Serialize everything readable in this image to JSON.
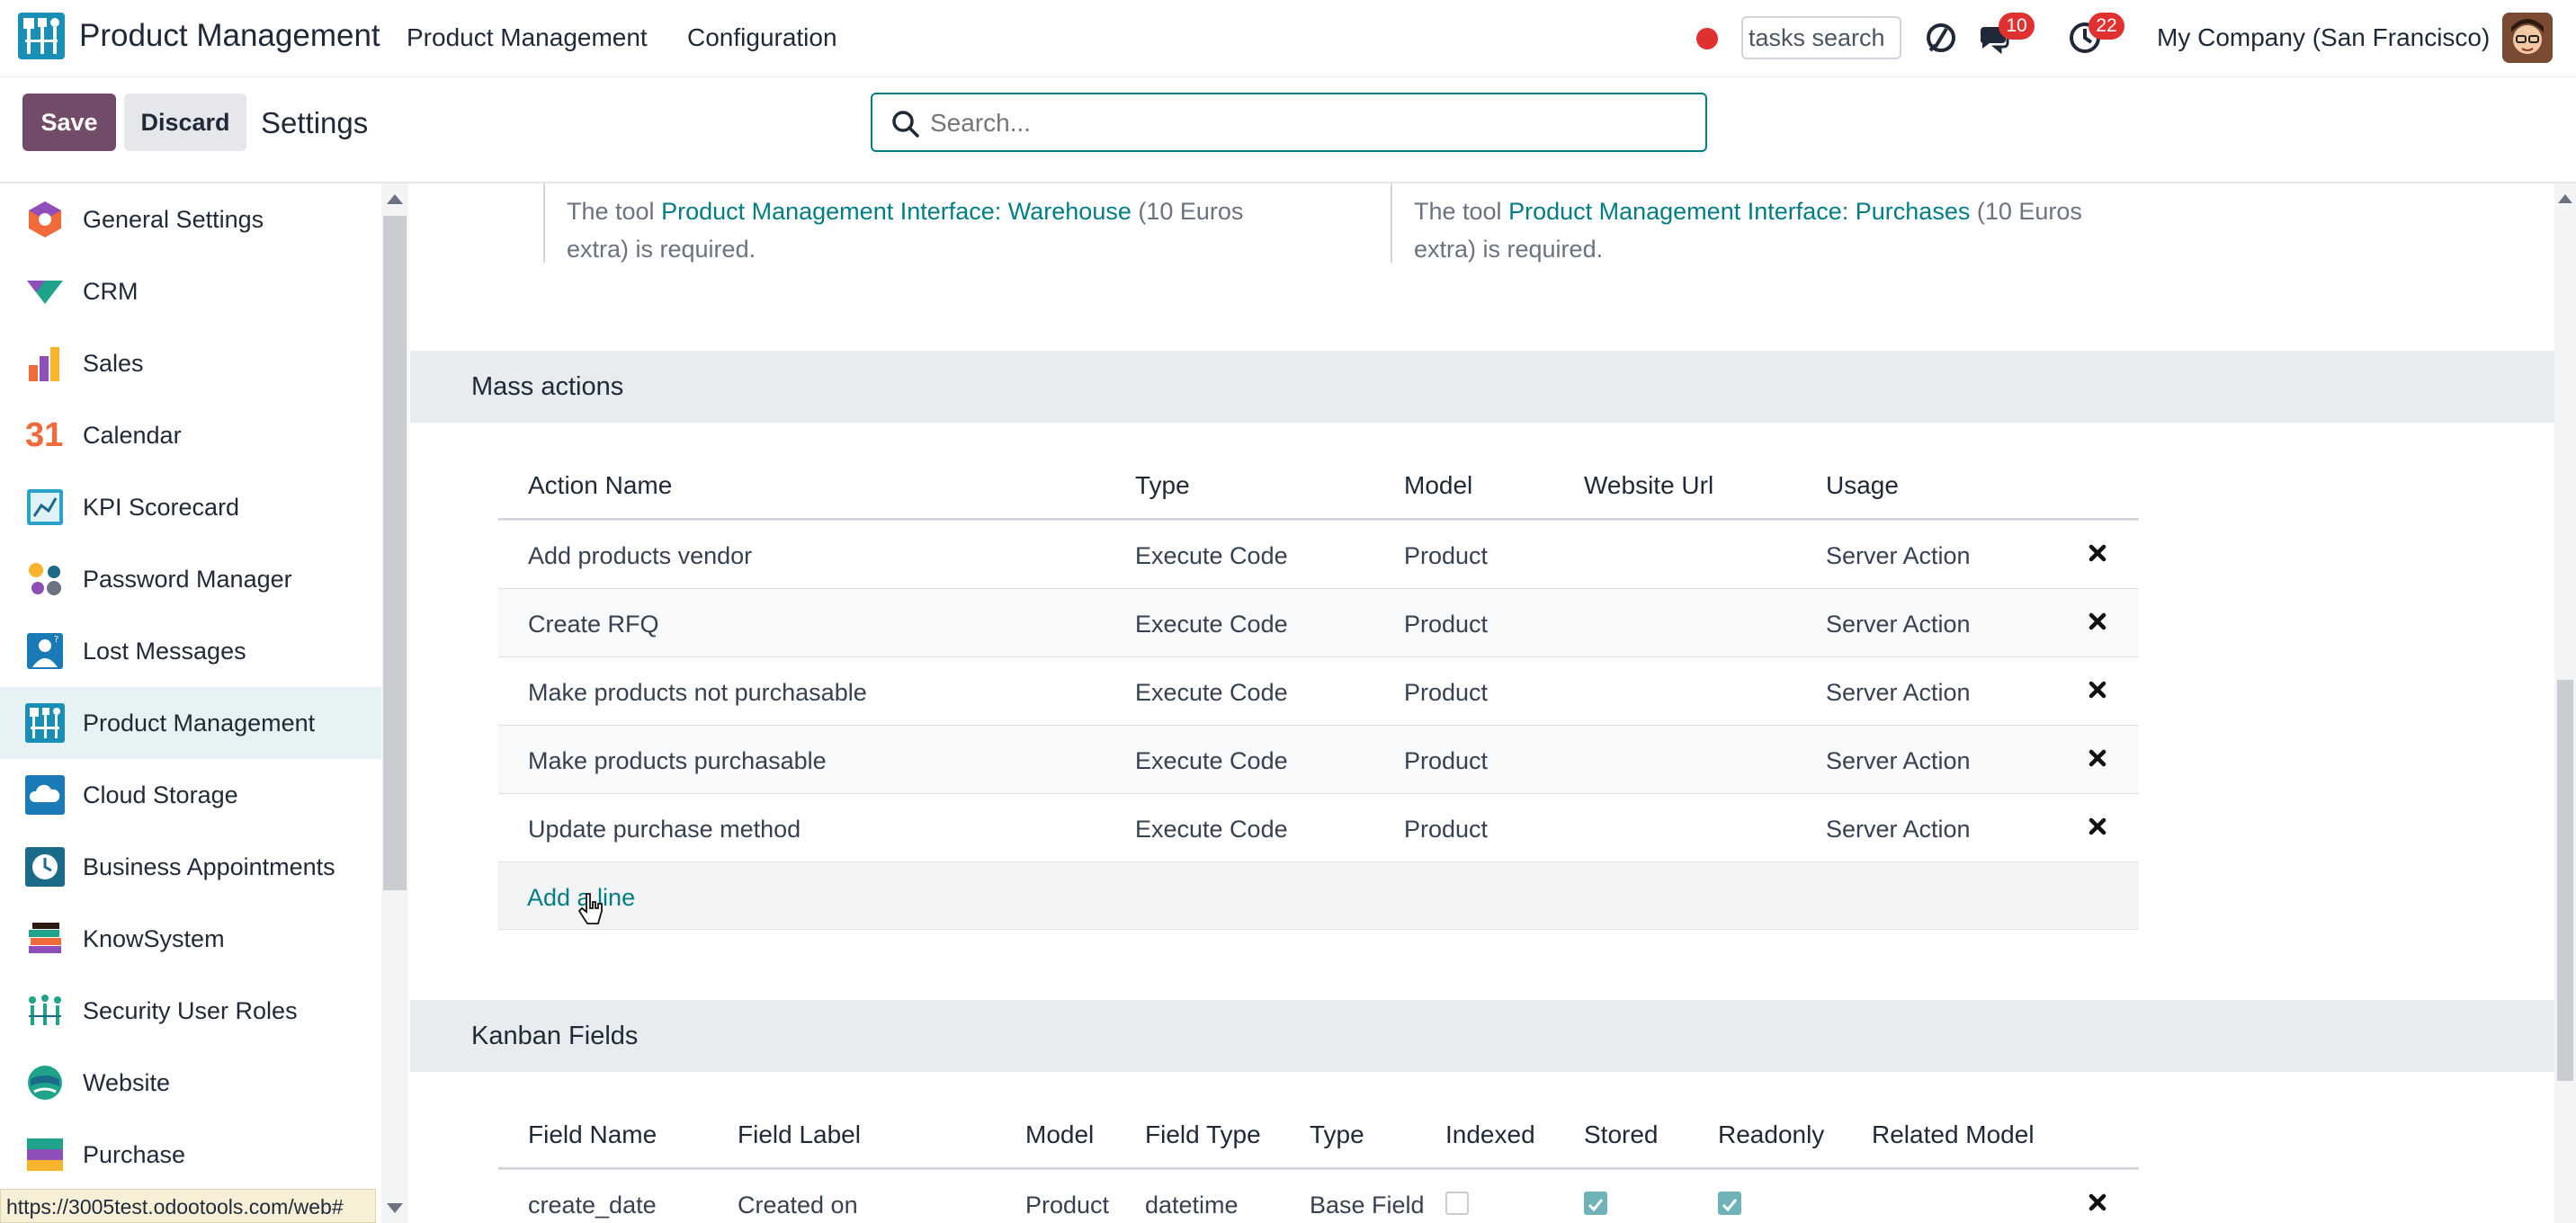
{
  "navbar": {
    "app_title": "Product Management",
    "menu": [
      "Product Management",
      "Configuration"
    ],
    "tasks_search_value": "tasks search",
    "messages_count": "10",
    "activities_count": "22",
    "company": "My Company (San Francisco)"
  },
  "control": {
    "save_label": "Save",
    "discard_label": "Discard",
    "breadcrumb": "Settings",
    "search_placeholder": "Search..."
  },
  "sidebar": {
    "items": [
      {
        "label": "General Settings",
        "icon": "general-settings-icon"
      },
      {
        "label": "CRM",
        "icon": "crm-icon"
      },
      {
        "label": "Sales",
        "icon": "sales-icon"
      },
      {
        "label": "Calendar",
        "icon": "calendar-icon"
      },
      {
        "label": "KPI Scorecard",
        "icon": "kpi-scorecard-icon"
      },
      {
        "label": "Password Manager",
        "icon": "password-manager-icon"
      },
      {
        "label": "Lost Messages",
        "icon": "lost-messages-icon"
      },
      {
        "label": "Product Management",
        "icon": "product-management-icon",
        "active": true
      },
      {
        "label": "Cloud Storage",
        "icon": "cloud-storage-icon"
      },
      {
        "label": "Business Appointments",
        "icon": "business-appointments-icon"
      },
      {
        "label": "KnowSystem",
        "icon": "knowsystem-icon"
      },
      {
        "label": "Security User Roles",
        "icon": "security-user-roles-icon"
      },
      {
        "label": "Website",
        "icon": "website-icon"
      },
      {
        "label": "Purchase",
        "icon": "purchase-icon"
      }
    ],
    "calendar_icon_text": "31"
  },
  "status_url": "https://3005test.odootools.com/web#",
  "requirements": [
    {
      "prefix": "The tool ",
      "link": "Product Management Interface: Warehouse",
      "suffix": " (10 Euros",
      "line2": "extra) is required."
    },
    {
      "prefix": "The tool ",
      "link": "Product Management Interface: Purchases",
      "suffix": " (10 Euros",
      "line2": "extra) is required."
    }
  ],
  "mass_actions": {
    "title": "Mass actions",
    "columns": [
      "Action Name",
      "Type",
      "Model",
      "Website Url",
      "Usage"
    ],
    "rows": [
      {
        "name": "Add products vendor",
        "type": "Execute Code",
        "model": "Product",
        "url": "",
        "usage": "Server Action"
      },
      {
        "name": "Create RFQ",
        "type": "Execute Code",
        "model": "Product",
        "url": "",
        "usage": "Server Action"
      },
      {
        "name": "Make products not purchasable",
        "type": "Execute Code",
        "model": "Product",
        "url": "",
        "usage": "Server Action"
      },
      {
        "name": "Make products purchasable",
        "type": "Execute Code",
        "model": "Product",
        "url": "",
        "usage": "Server Action"
      },
      {
        "name": "Update purchase method",
        "type": "Execute Code",
        "model": "Product",
        "url": "",
        "usage": "Server Action"
      }
    ],
    "add_line": "Add a line"
  },
  "kanban_fields": {
    "title": "Kanban Fields",
    "columns": [
      "Field Name",
      "Field Label",
      "Model",
      "Field Type",
      "Type",
      "Indexed",
      "Stored",
      "Readonly",
      "Related Model"
    ],
    "rows": [
      {
        "field_name": "create_date",
        "field_label": "Created on",
        "model": "Product",
        "field_type": "datetime",
        "type": "Base Field",
        "indexed": false,
        "stored": true,
        "readonly": true,
        "related_model": ""
      }
    ]
  },
  "colors": {
    "brand": "#714b67",
    "accent": "#017e84",
    "badge": "#e03131"
  }
}
